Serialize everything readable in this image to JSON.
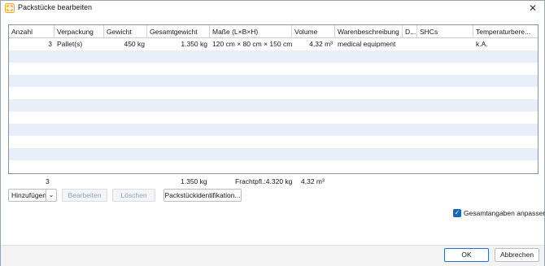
{
  "window": {
    "title": "Packstücke bearbeiten",
    "close_glyph": "✕",
    "icon": "app-package-icon",
    "accent_color": "#f5a623"
  },
  "table": {
    "headers": [
      "Anzahl",
      "Verpackung",
      "Gewicht",
      "Gesamtgewicht",
      "Maße (L×B×H)",
      "Volume",
      "Warenbeschreibung",
      "D...",
      "SHCs",
      "Temperaturbere..."
    ],
    "rows": [
      [
        "3",
        "Pallet(s)",
        "450 kg",
        "1.350 kg",
        "120 cm × 80 cm × 150 cm",
        "4,32 m³",
        "medical equipment",
        "",
        "",
        "k.A."
      ]
    ],
    "alt_row_color": "#e9eff8"
  },
  "totals": {
    "anzahl": "3",
    "gesamtgewicht": "1.350 kg",
    "frachtpfl": "Frachtpfl.:4.320 kg",
    "volume": "4,32 m³"
  },
  "actions": {
    "add": "Hinzufügen",
    "add_dropdown": "⌄",
    "edit": "Bearbeiten",
    "delete": "Löschen",
    "identification": "Packstückidentifikation..."
  },
  "options": {
    "adjust_totals_label": "Gesamtangaben anpassen",
    "adjust_totals_checked": true,
    "check_glyph": "✓"
  },
  "footer": {
    "ok": "OK",
    "cancel": "Abbrechen"
  }
}
